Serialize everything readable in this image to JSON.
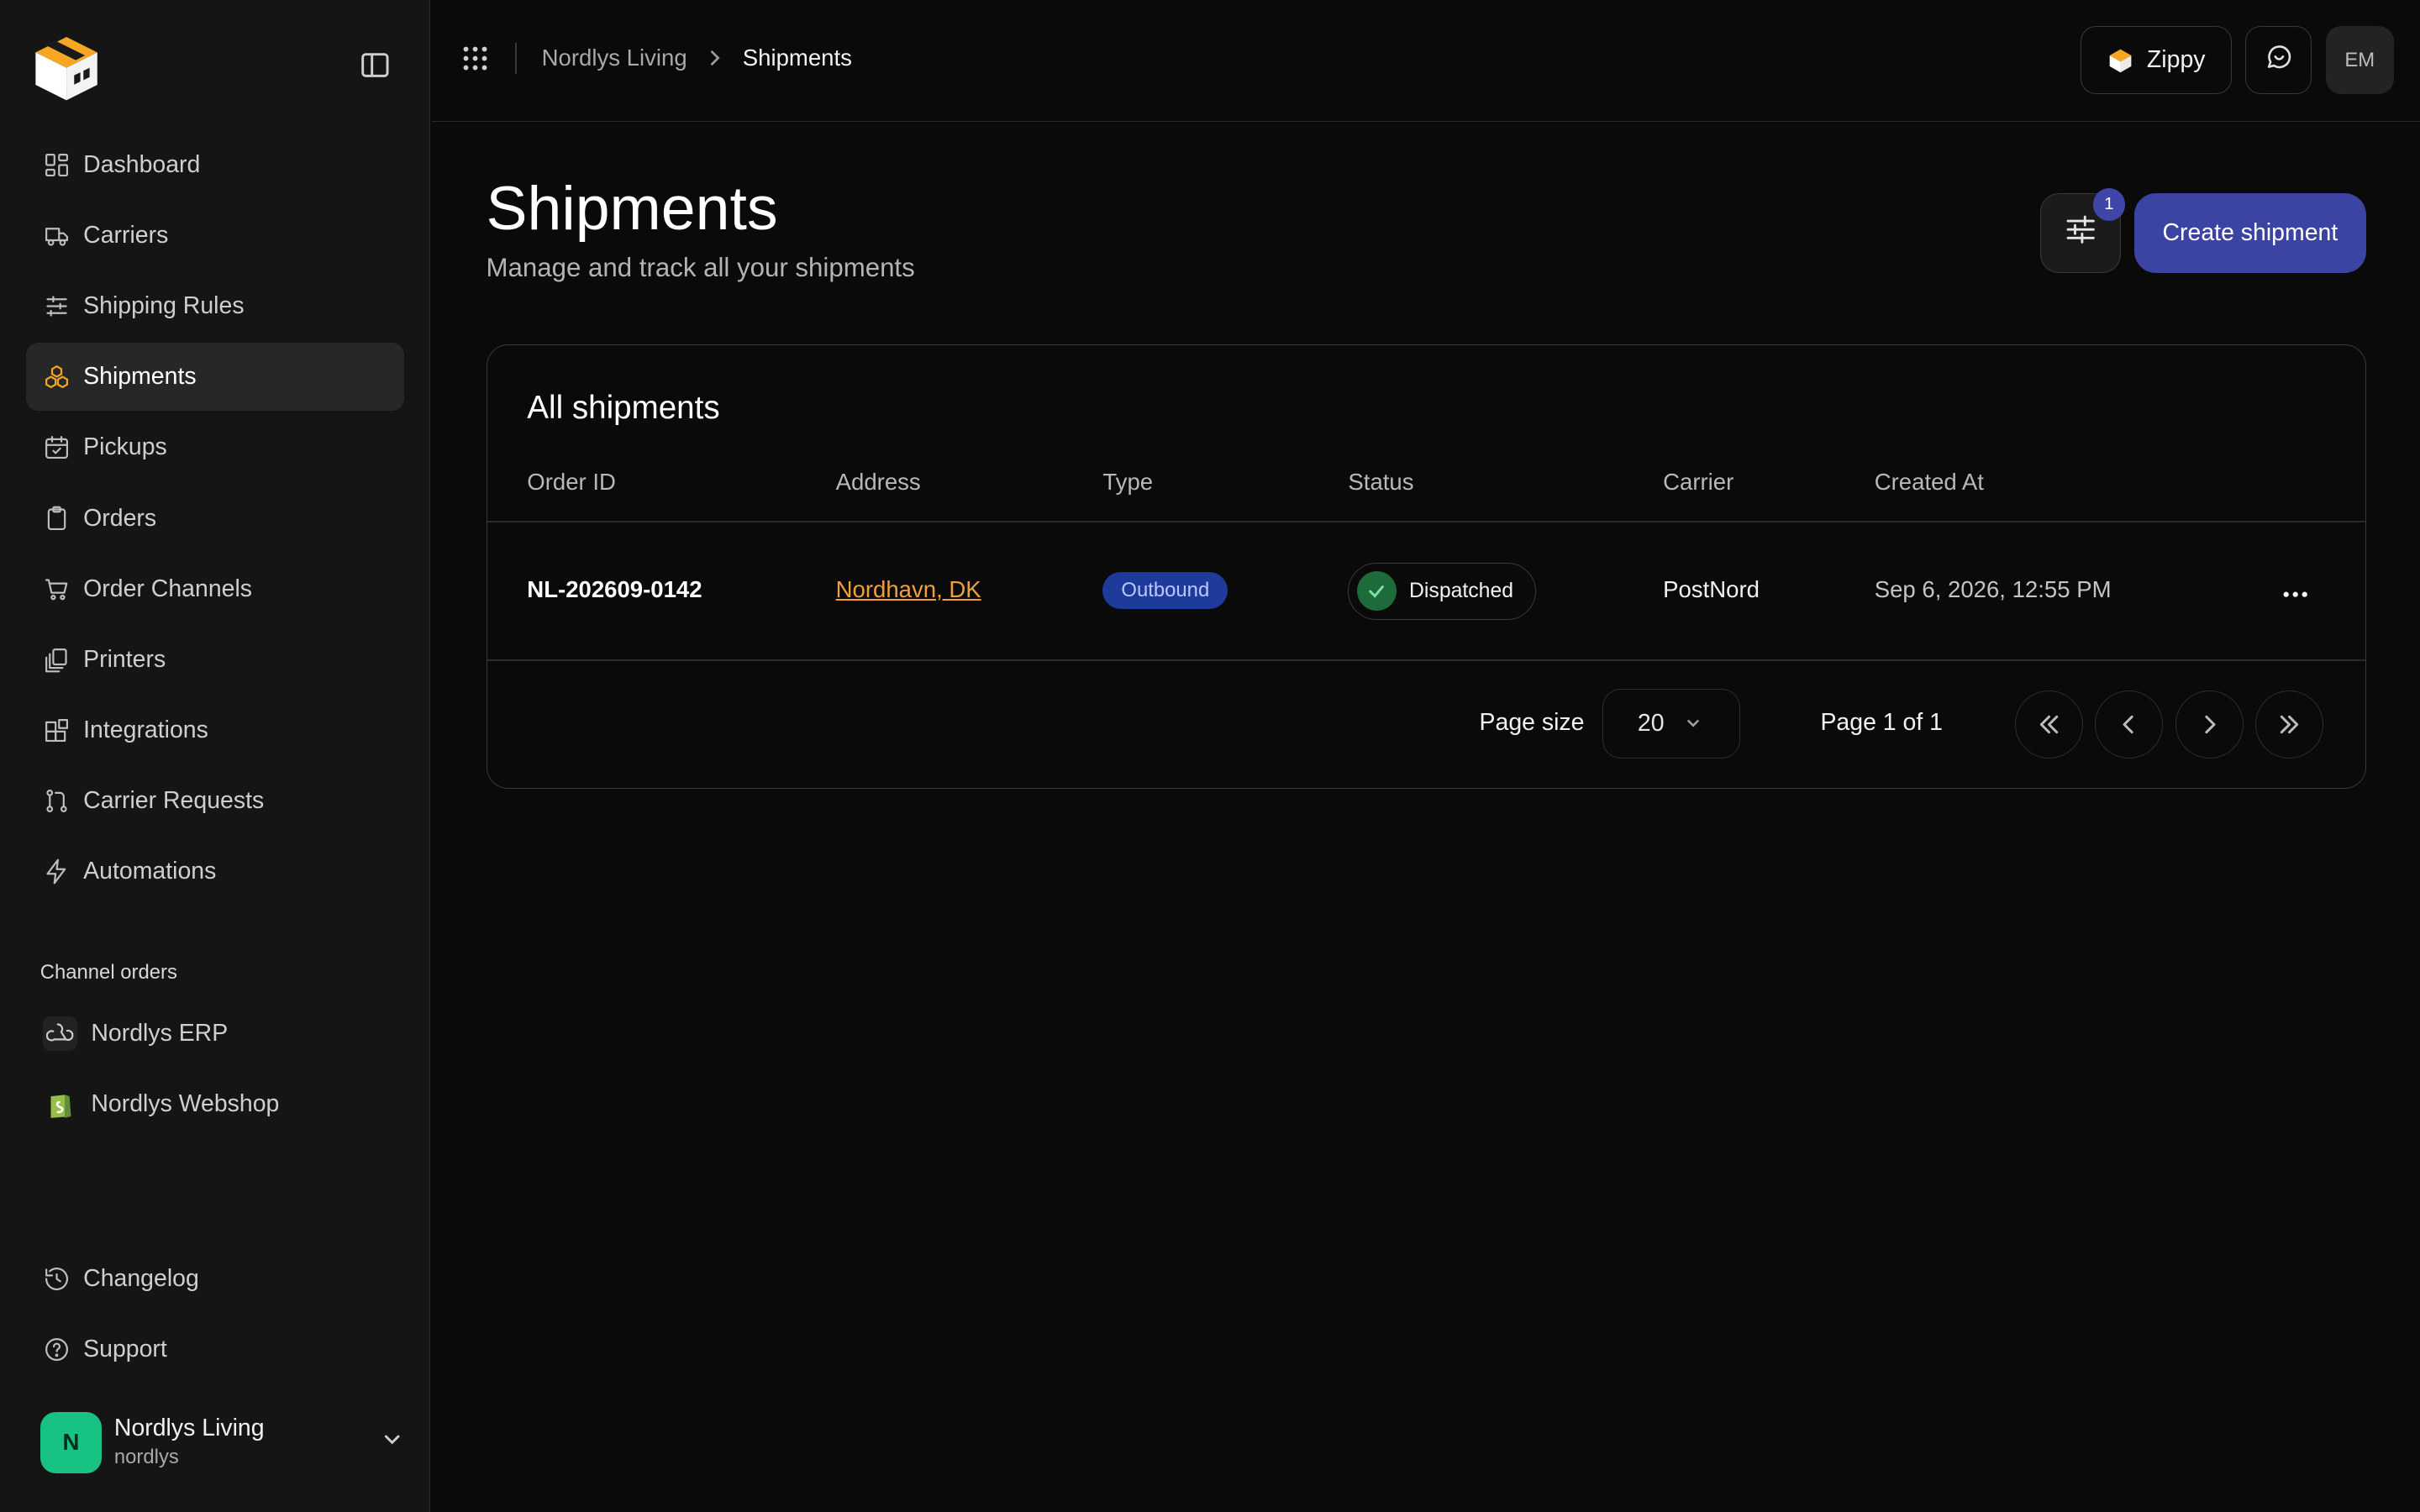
{
  "sidebar": {
    "items": [
      {
        "label": "Dashboard",
        "icon": "layout-dashboard-icon"
      },
      {
        "label": "Carriers",
        "icon": "truck-icon"
      },
      {
        "label": "Shipping Rules",
        "icon": "sliders-icon"
      },
      {
        "label": "Shipments",
        "icon": "boxes-icon",
        "active": true
      },
      {
        "label": "Pickups",
        "icon": "calendar-check-icon"
      },
      {
        "label": "Orders",
        "icon": "clipboard-icon"
      },
      {
        "label": "Order Channels",
        "icon": "shopping-cart-icon"
      },
      {
        "label": "Printers",
        "icon": "printer-copies-icon"
      },
      {
        "label": "Integrations",
        "icon": "blocks-icon"
      },
      {
        "label": "Carrier Requests",
        "icon": "git-pull-request-icon"
      },
      {
        "label": "Automations",
        "icon": "zap-icon"
      }
    ],
    "channels_title": "Channel orders",
    "channels": [
      {
        "label": "Nordlys ERP",
        "icon": "webhook-icon"
      },
      {
        "label": "Nordlys Webshop",
        "icon": "shopify-icon"
      }
    ],
    "bottom": [
      {
        "label": "Changelog",
        "icon": "history-icon"
      },
      {
        "label": "Support",
        "icon": "help-circle-icon"
      }
    ],
    "user": {
      "initial": "N",
      "name": "Nordlys Living",
      "handle": "nordlys"
    }
  },
  "topbar": {
    "breadcrumb": {
      "parent": "Nordlys Living",
      "current": "Shipments"
    },
    "zippy_label": "Zippy",
    "user_initials": "EM"
  },
  "page": {
    "title": "Shipments",
    "subtitle": "Manage and track all your shipments",
    "filter_count": "1",
    "create_label": "Create shipment"
  },
  "table": {
    "title": "All shipments",
    "columns": [
      "Order ID",
      "Address",
      "Type",
      "Status",
      "Carrier",
      "Created At"
    ],
    "rows": [
      {
        "order_id": "NL-202609-0142",
        "address": "Nordhavn, DK",
        "type": "Outbound",
        "status": "Dispatched",
        "carrier": "PostNord",
        "created_at": "Sep 6, 2026, 12:55 PM"
      }
    ]
  },
  "pagination": {
    "page_size_label": "Page size",
    "page_size": "20",
    "page_info": "Page 1 of 1"
  },
  "colors": {
    "accent": "#3c44a3",
    "brand_orange": "#f5a623",
    "link": "#f0a03a",
    "status_green": "#1d6a3a",
    "avatar_green": "#17c283",
    "background": "#0b0a0a",
    "sidebar": "#161515"
  }
}
